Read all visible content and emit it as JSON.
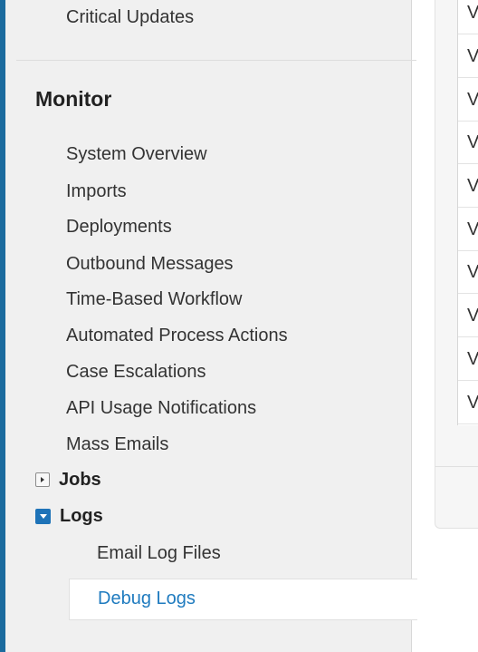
{
  "sidebar": {
    "prev_item": "Critical Updates",
    "section_title": "Monitor",
    "items": [
      "System Overview",
      "Imports",
      "Deployments",
      "Outbound Messages",
      "Time-Based Workflow",
      "Automated Process Actions",
      "Case Escalations",
      "API Usage Notifications",
      "Mass Emails"
    ],
    "jobs": {
      "label": "Jobs",
      "state": "collapsed",
      "icon": "expand-icon"
    },
    "logs": {
      "label": "Logs",
      "state": "expanded",
      "icon": "collapse-icon",
      "children": [
        "Email Log Files",
        "Debug Logs"
      ],
      "selected": "Debug Logs"
    }
  },
  "table": {
    "rows": [
      "V",
      "V",
      "V",
      "V",
      "V",
      "V",
      "V",
      "V",
      "V",
      "V"
    ]
  },
  "colors": {
    "accent_border": "#1b6b9e",
    "selected_link": "#1f7bbf",
    "expanded_toggle": "#1e73b8"
  }
}
